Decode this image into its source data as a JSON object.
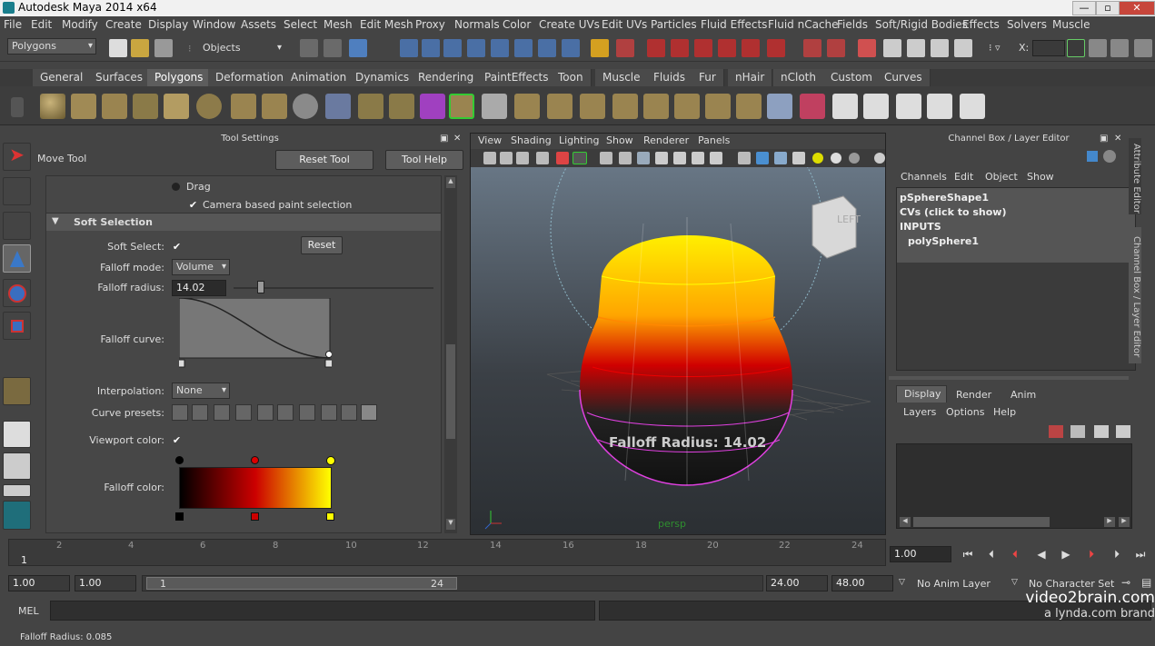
{
  "app": {
    "title": "Autodesk Maya 2014 x64"
  },
  "menubar": [
    "File",
    "Edit",
    "Modify",
    "Create",
    "Display",
    "Window",
    "Assets",
    "Select",
    "Mesh",
    "Edit Mesh",
    "Proxy",
    "Normals",
    "Color",
    "Create UVs",
    "Edit UVs",
    "Particles",
    "Fluid Effects",
    "Fluid nCache",
    "Fields",
    "Soft/Rigid Bodies",
    "Effects",
    "Solvers",
    "Muscle"
  ],
  "statusline": {
    "menuset": "Polygons",
    "objects_label": "Objects",
    "x_label": "X:"
  },
  "shelf_tabs": [
    "General",
    "Surfaces",
    "Polygons",
    "Deformation",
    "Animation",
    "Dynamics",
    "Rendering",
    "PaintEffects",
    "Toon",
    "Muscle",
    "Fluids",
    "Fur",
    "nHair",
    "nCloth",
    "Custom",
    "Curves"
  ],
  "shelf_active": "Polygons",
  "tool_settings": {
    "panel_title": "Tool Settings",
    "tool_name": "Move Tool",
    "reset_tool": "Reset Tool",
    "tool_help": "Tool Help",
    "drag": "Drag",
    "camera_paint": "Camera based paint selection",
    "section": "Soft Selection",
    "soft_select": "Soft Select:",
    "reset": "Reset",
    "falloff_mode_label": "Falloff mode:",
    "falloff_mode": "Volume",
    "falloff_radius_label": "Falloff radius:",
    "falloff_radius": "14.02",
    "falloff_curve": "Falloff curve:",
    "interpolation_label": "Interpolation:",
    "interpolation": "None",
    "curve_presets": "Curve presets:",
    "viewport_color": "Viewport color:",
    "falloff_color": "Falloff color:"
  },
  "viewport": {
    "menus": [
      "View",
      "Shading",
      "Lighting",
      "Show",
      "Renderer",
      "Panels"
    ],
    "hud": "Falloff Radius: 14.02",
    "cube_label": "LEFT",
    "camera": "persp"
  },
  "channel_box": {
    "panel_title": "Channel Box / Layer Editor",
    "menus": [
      "Channels",
      "Edit",
      "Object",
      "Show"
    ],
    "items": [
      "pSphereShape1",
      "CVs (click to show)",
      "INPUTS",
      "polySphere1"
    ],
    "layer_tabs": [
      "Display",
      "Render",
      "Anim"
    ],
    "layer_menus": [
      "Layers",
      "Options",
      "Help"
    ],
    "side_tabs": [
      "Attribute Editor",
      "Channel Box / Layer Editor"
    ]
  },
  "timeline": {
    "ticks": [
      "2",
      "4",
      "6",
      "8",
      "10",
      "12",
      "14",
      "16",
      "18",
      "20",
      "22",
      "24"
    ],
    "current": "1",
    "current_time": "1.00"
  },
  "range": {
    "start": "1.00",
    "playback_start": "1.00",
    "slider_start": "1",
    "slider_end": "24",
    "playback_end": "24.00",
    "end": "48.00",
    "anim_layer": "No Anim Layer",
    "char_set": "No Character Set"
  },
  "command": {
    "lang": "MEL"
  },
  "help": {
    "text": "Falloff Radius: 0.085"
  },
  "watermark": {
    "line1": "video2brain.com",
    "line2": "a lynda.com brand"
  }
}
